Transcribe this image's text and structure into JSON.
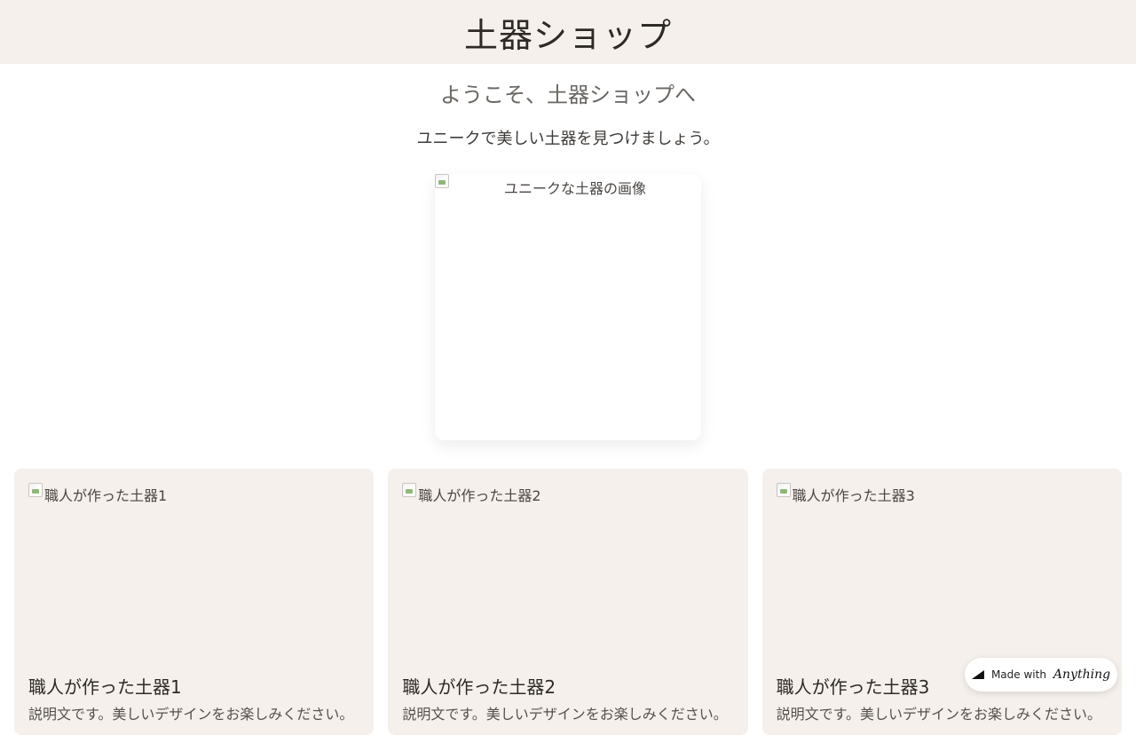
{
  "header": {
    "title": "土器ショップ"
  },
  "welcome": {
    "heading": "ようこそ、土器ショップへ",
    "subtitle": "ユニークで美しい土器を見つけましょう。"
  },
  "hero": {
    "alt": "ユニークな土器の画像",
    "icon": "broken-image-icon"
  },
  "products": [
    {
      "alt": "職人が作った土器1",
      "name": "職人が作った土器1",
      "description": "説明文です。美しいデザインをお楽しみください。"
    },
    {
      "alt": "職人が作った土器2",
      "name": "職人が作った土器2",
      "description": "説明文です。美しいデザインをお楽しみください。"
    },
    {
      "alt": "職人が作った土器3",
      "name": "職人が作った土器3",
      "description": "説明文です。美しいデザインをお楽しみください。"
    }
  ],
  "badge": {
    "prefix": "Made with",
    "brand": "Anything",
    "icon": "anything-logo-icon"
  },
  "colors": {
    "header_bg": "#f5f0eb",
    "card_bg": "#f5f0eb",
    "text": "#3a3633"
  }
}
